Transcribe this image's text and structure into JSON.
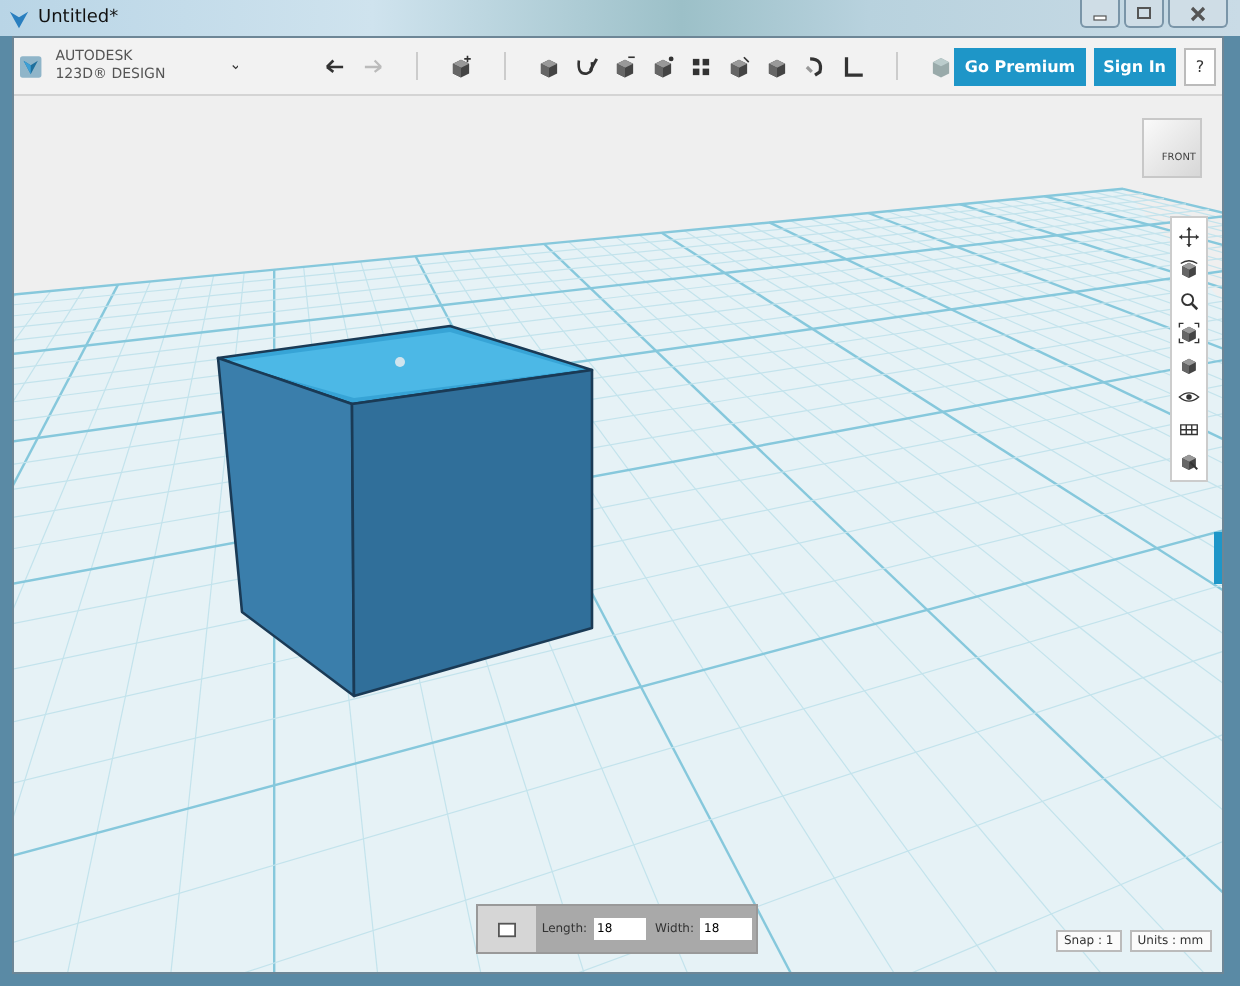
{
  "window": {
    "title": "Untitled*"
  },
  "brand": {
    "company": "AUTODESK",
    "product": "123D® DESIGN"
  },
  "account_buttons": [
    {
      "label": "Go Premium"
    },
    {
      "label": "Sign In"
    }
  ],
  "help_button": {
    "label": "?"
  },
  "view_cube": {
    "face": "FRONT"
  },
  "sketch_panel": {
    "fields": [
      {
        "label": "Length:",
        "value": "18"
      },
      {
        "label": "Width:",
        "value": "18"
      }
    ]
  },
  "status": [
    {
      "label": "Snap : 1"
    },
    {
      "label": "Units : mm"
    }
  ]
}
